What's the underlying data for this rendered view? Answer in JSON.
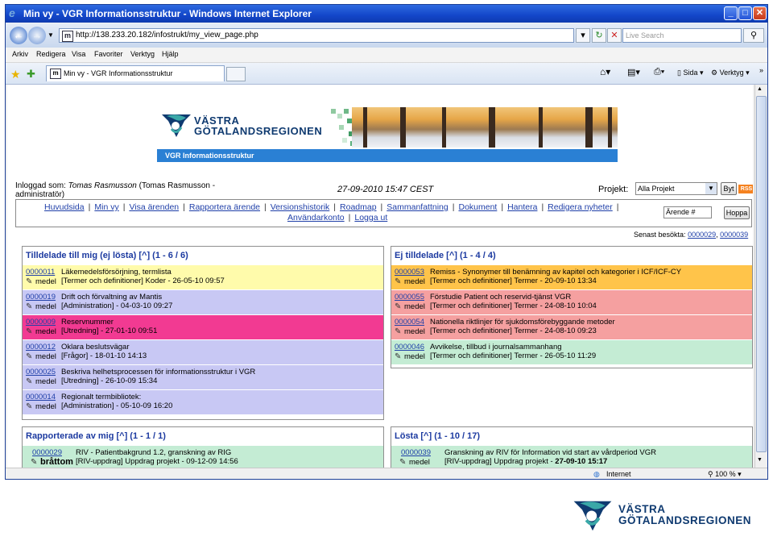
{
  "window": {
    "title": "Min vy - VGR Informationsstruktur - Windows Internet Explorer",
    "controls": [
      "minimize",
      "maximize",
      "close"
    ]
  },
  "address": {
    "url": "http://138.233.20.182/infostrukt/my_view_page.php",
    "search_placeholder": "Live Search"
  },
  "menu": [
    "Arkiv",
    "Redigera",
    "Visa",
    "Favoriter",
    "Verktyg",
    "Hjälp"
  ],
  "tab": {
    "label": "Min vy - VGR Informationsstruktur"
  },
  "commands": {
    "page": "Sida",
    "tools": "Verktyg"
  },
  "header": {
    "brand_line1": "VÄSTRA",
    "brand_line2": "GÖTALANDSREGIONEN",
    "bar": "VGR Informationsstruktur"
  },
  "user": {
    "line1": "Inloggad som: Tomas Rasmusson (Tomas Rasmusson -",
    "line2": "administratör)",
    "label": "Inloggad som:",
    "name": "Tomas Rasmusson",
    "rest": " (Tomas Rasmusson -"
  },
  "datetime": "27-09-2010 15:47 CEST",
  "project": {
    "label": "Projekt:",
    "selected": "Alla Projekt",
    "button": "Byt",
    "rss": "RSS"
  },
  "nav": {
    "links": [
      "Huvudsida",
      "Min vy",
      "Visa ärenden",
      "Rapportera ärende",
      "Versionshistorik",
      "Roadmap",
      "Sammanfattning",
      "Dokument",
      "Hantera",
      "Redigera nyheter",
      "Användarkonto",
      "Logga ut"
    ],
    "jump_placeholder": "Ärende #",
    "jump_button": "Hoppa"
  },
  "last_visited": {
    "label": "Senast besökta:",
    "items": [
      "0000029",
      "0000039"
    ]
  },
  "panels": {
    "assigned": {
      "title": "Tilldelade till mig (ej lösta) [^] (1 - 6 / 6)",
      "rows": [
        {
          "id": "0000011",
          "prio": "medel",
          "summary": "Läkemedelsförsörjning, termlista",
          "meta": "[Termer och definitioner] Koder - 26-05-10 09:57",
          "color": "#fffbab"
        },
        {
          "id": "0000019",
          "prio": "medel",
          "summary": "Drift och förvaltning av Mantis",
          "meta": "[Administration] - 04-03-10 09:27",
          "color": "#c8c8f4"
        },
        {
          "id": "0000009",
          "prio": "medel",
          "summary": "Reservnummer",
          "meta": "[Utredning] - 27-01-10 09:51",
          "color": "#f23a92"
        },
        {
          "id": "0000012",
          "prio": "medel",
          "summary": "Oklara beslutsvägar",
          "meta": "[Frågor] - 18-01-10 14:13",
          "color": "#c8c8f4"
        },
        {
          "id": "0000025",
          "prio": "medel",
          "summary": "Beskriva helhetsprocessen för informationsstruktur i VGR",
          "meta": "[Utredning] - 26-10-09 15:34",
          "color": "#c8c8f4"
        },
        {
          "id": "0000014",
          "prio": "medel",
          "summary": "Regionalt termbibliotek:",
          "meta": "[Administration] - 05-10-09 16:20",
          "color": "#c8c8f4"
        }
      ]
    },
    "unassigned": {
      "title": "Ej tilldelade [^] (1 - 4 / 4)",
      "rows": [
        {
          "id": "0000053",
          "prio": "medel",
          "summary": "Remiss - Synonymer till benämning av kapitel och kategorier i ICF/ICF-CY",
          "meta": "[Termer och definitioner] Termer - 20-09-10 13:34",
          "color": "#ffc44a"
        },
        {
          "id": "0000055",
          "prio": "medel",
          "summary": "Förstudie Patient och reservid-tjänst VGR",
          "meta": "[Termer och definitioner] Termer - 24-08-10 10:04",
          "color": "#f5a0a0"
        },
        {
          "id": "0000054",
          "prio": "medel",
          "summary": "Nationella riktlinjer för sjukdomsförebyggande metoder",
          "meta": "[Termer och definitioner] Termer - 24-08-10 09:23",
          "color": "#f5a0a0"
        },
        {
          "id": "0000046",
          "prio": "medel",
          "summary": "Avvikelse, tillbud i journalsammanhang",
          "meta": "[Termer och definitioner] Termer - 26-05-10 11:29",
          "color": "#c4ecd4"
        }
      ]
    },
    "reported": {
      "title": "Rapporterade av mig [^] (1 - 1 / 1)",
      "rows": [
        {
          "id": "0000029",
          "prio": "bråttom",
          "summary": "RIV - Patientbakgrund 1.2, granskning av RIG",
          "meta": "[RIV-uppdrag] Uppdrag projekt - 09-12-09 14:56",
          "color": "#c4ecd4"
        }
      ]
    },
    "resolved": {
      "title": "Lösta [^] (1 - 10 / 17)",
      "rows": [
        {
          "id": "0000039",
          "prio": "medel",
          "summary": "Granskning av RIV för Information vid start av vårdperiod VGR",
          "meta_prefix": "[RIV-uppdrag] Uppdrag projekt - ",
          "meta_date": "27-09-10 15:17",
          "color": "#c4ecd4"
        }
      ]
    }
  },
  "status": {
    "zone": "Internet",
    "zoom": "100 %"
  },
  "footer_brand": {
    "line1": "VÄSTRA",
    "line2": "GÖTALANDSREGIONEN"
  }
}
